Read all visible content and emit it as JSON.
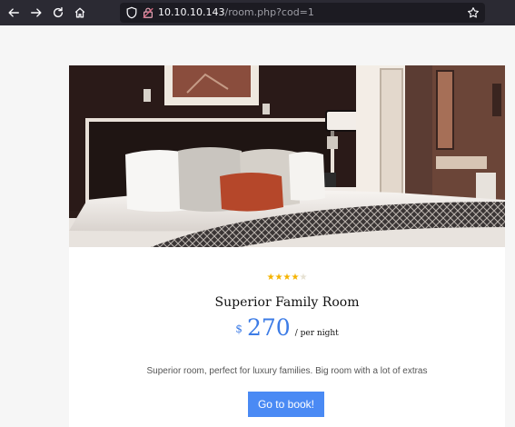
{
  "browser": {
    "url_host": "10.10.10.143",
    "url_path": "/room.php?cod=1",
    "icons": [
      "back-arrow-icon",
      "forward-arrow-icon",
      "reload-icon",
      "home-icon",
      "shield-icon",
      "lock-icon",
      "bookmark-star-icon"
    ]
  },
  "room": {
    "rating": 4,
    "rating_max": 5,
    "stars_full": "★★★★",
    "stars_empty": "★",
    "name": "Superior Family Room",
    "currency": "$",
    "price": "270",
    "per_night": "/ per night",
    "description": "Superior room, perfect for luxury families. Big room with a lot of extras",
    "book_label": "Go to book!"
  },
  "colors": {
    "accent": "#4a8af4",
    "price": "#3d7ce6",
    "star": "#f5b301",
    "toolbar": "#2b2a33"
  }
}
